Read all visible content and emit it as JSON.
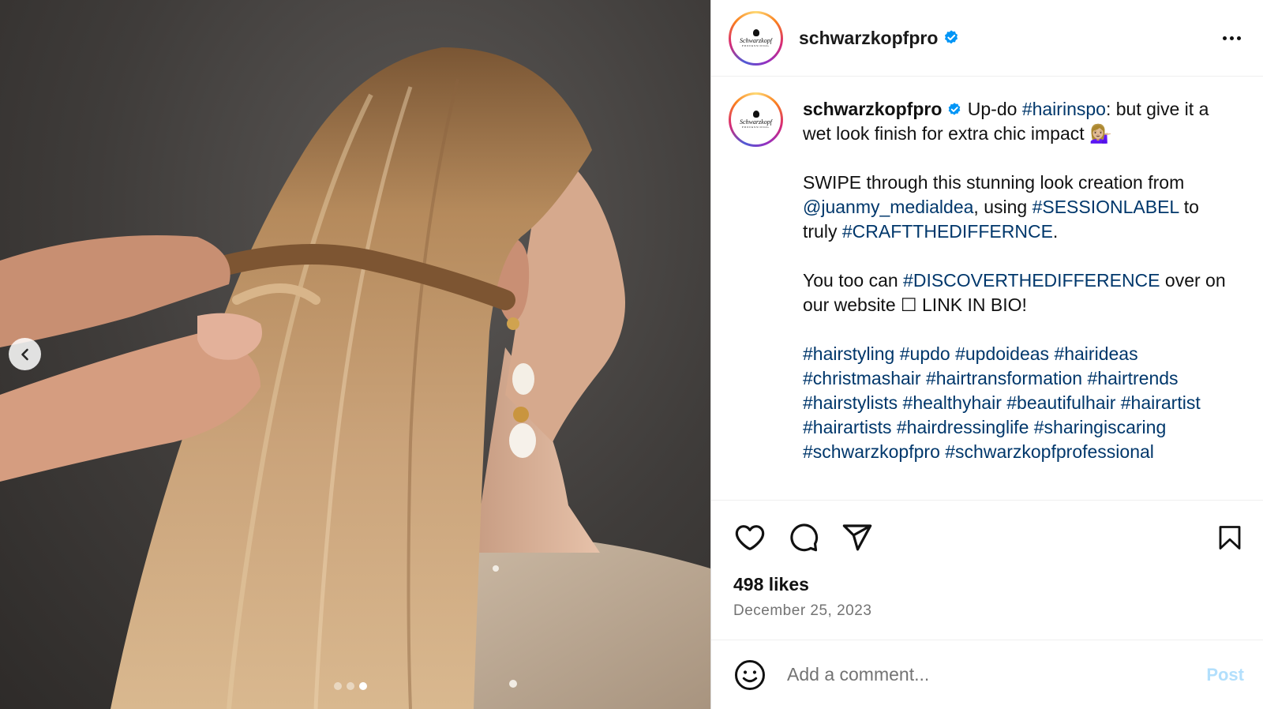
{
  "media": {
    "carousel_total": 3,
    "carousel_active_index": 2,
    "prev_icon": "chevron-left-icon"
  },
  "header": {
    "username": "schwarzkopfpro",
    "avatar_brand": "Schwarzkopf",
    "avatar_sub": "PROFESSIONAL",
    "more_icon": "more-horizontal-icon"
  },
  "caption": {
    "username": "schwarzkopfpro",
    "line1_pre": " Up-do ",
    "line1_tag": "#hairinspo",
    "line1_post": ": but give it a wet look finish for extra chic impact 💁🏼‍♀️",
    "p2_pre": "SWIPE through this stunning look creation from ",
    "p2_mention": "@juanmy_medialdea",
    "p2_mid": ", using ",
    "p2_tag1": "#SESSIONLABEL",
    "p2_mid2": " to truly ",
    "p2_tag2": "#CRAFTTHEDIFFERNCE",
    "p2_post": ".",
    "p3_pre": "You too can ",
    "p3_tag": "#DISCOVERTHEDIFFERENCE",
    "p3_post": " over on our website ☐ LINK IN BIO!",
    "hashtags": [
      "#hairstyling",
      "#updo",
      "#updoideas",
      "#hairideas",
      "#christmashair",
      "#hairtransformation",
      "#hairtrends",
      "#hairstylists",
      "#healthyhair",
      "#beautifulhair",
      "#hairartist",
      "#hairartists",
      "#hairdressinglife",
      "#sharingiscaring",
      "#schwarzkopfpro",
      "#schwarzkopfprofessional"
    ]
  },
  "actions": {
    "like_icon": "heart-icon",
    "comment_icon": "comment-icon",
    "share_icon": "share-icon",
    "save_icon": "bookmark-icon",
    "likes": "498 likes",
    "date": "December 25, 2023"
  },
  "comment_box": {
    "emoji_icon": "smiley-icon",
    "placeholder": "Add a comment...",
    "post_label": "Post"
  },
  "colors": {
    "link": "#00376b",
    "verified": "#0095f6",
    "post_disabled": "#b2dffc",
    "meta_gray": "#737373"
  }
}
